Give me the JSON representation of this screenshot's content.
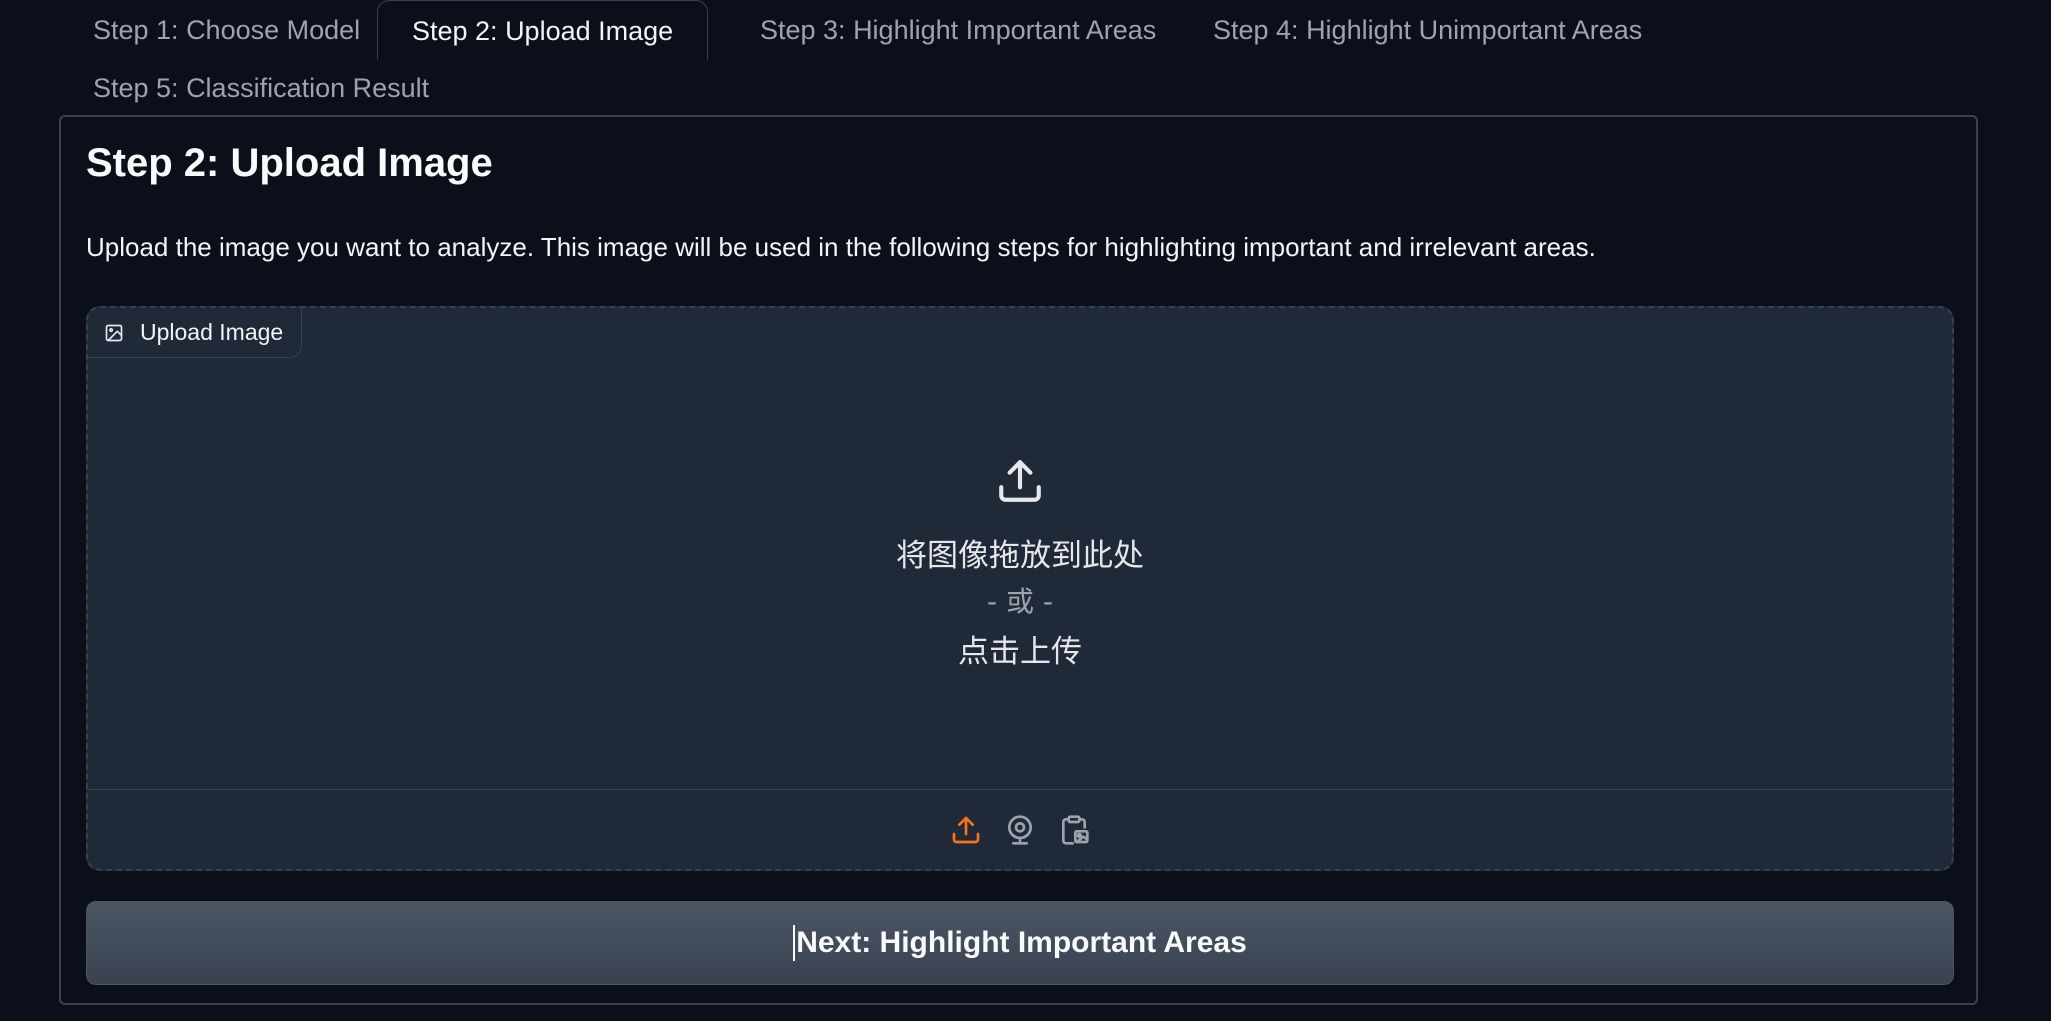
{
  "tabs": [
    {
      "label": "Step 1: Choose Model",
      "active": false
    },
    {
      "label": "Step 2: Upload Image",
      "active": true
    },
    {
      "label": "Step 3: Highlight Important Areas",
      "active": false
    },
    {
      "label": "Step 4: Highlight Unimportant Areas",
      "active": false
    },
    {
      "label": "Step 5: Classification Result",
      "active": false
    }
  ],
  "panel": {
    "title": "Step 2: Upload Image",
    "description": "Upload the image you want to analyze. This image will be used in the following steps for highlighting important and irrelevant areas."
  },
  "upload": {
    "label": "Upload Image",
    "label_icon": "image-icon",
    "drop_text": "将图像拖放到此处",
    "or_text": "- 或 -",
    "click_text": "点击上传",
    "sources": [
      {
        "name": "upload-source",
        "icon": "upload-icon",
        "active": true
      },
      {
        "name": "webcam-source",
        "icon": "webcam-icon",
        "active": false
      },
      {
        "name": "clipboard-source",
        "icon": "clipboard-icon",
        "active": false
      }
    ]
  },
  "next_button": {
    "label": "Next: Highlight Important Areas"
  },
  "colors": {
    "background": "#0b0f19",
    "panel_border": "#374151",
    "upload_bg": "#1f2937",
    "accent_orange": "#f97316",
    "button_bg": "#4b5563"
  }
}
